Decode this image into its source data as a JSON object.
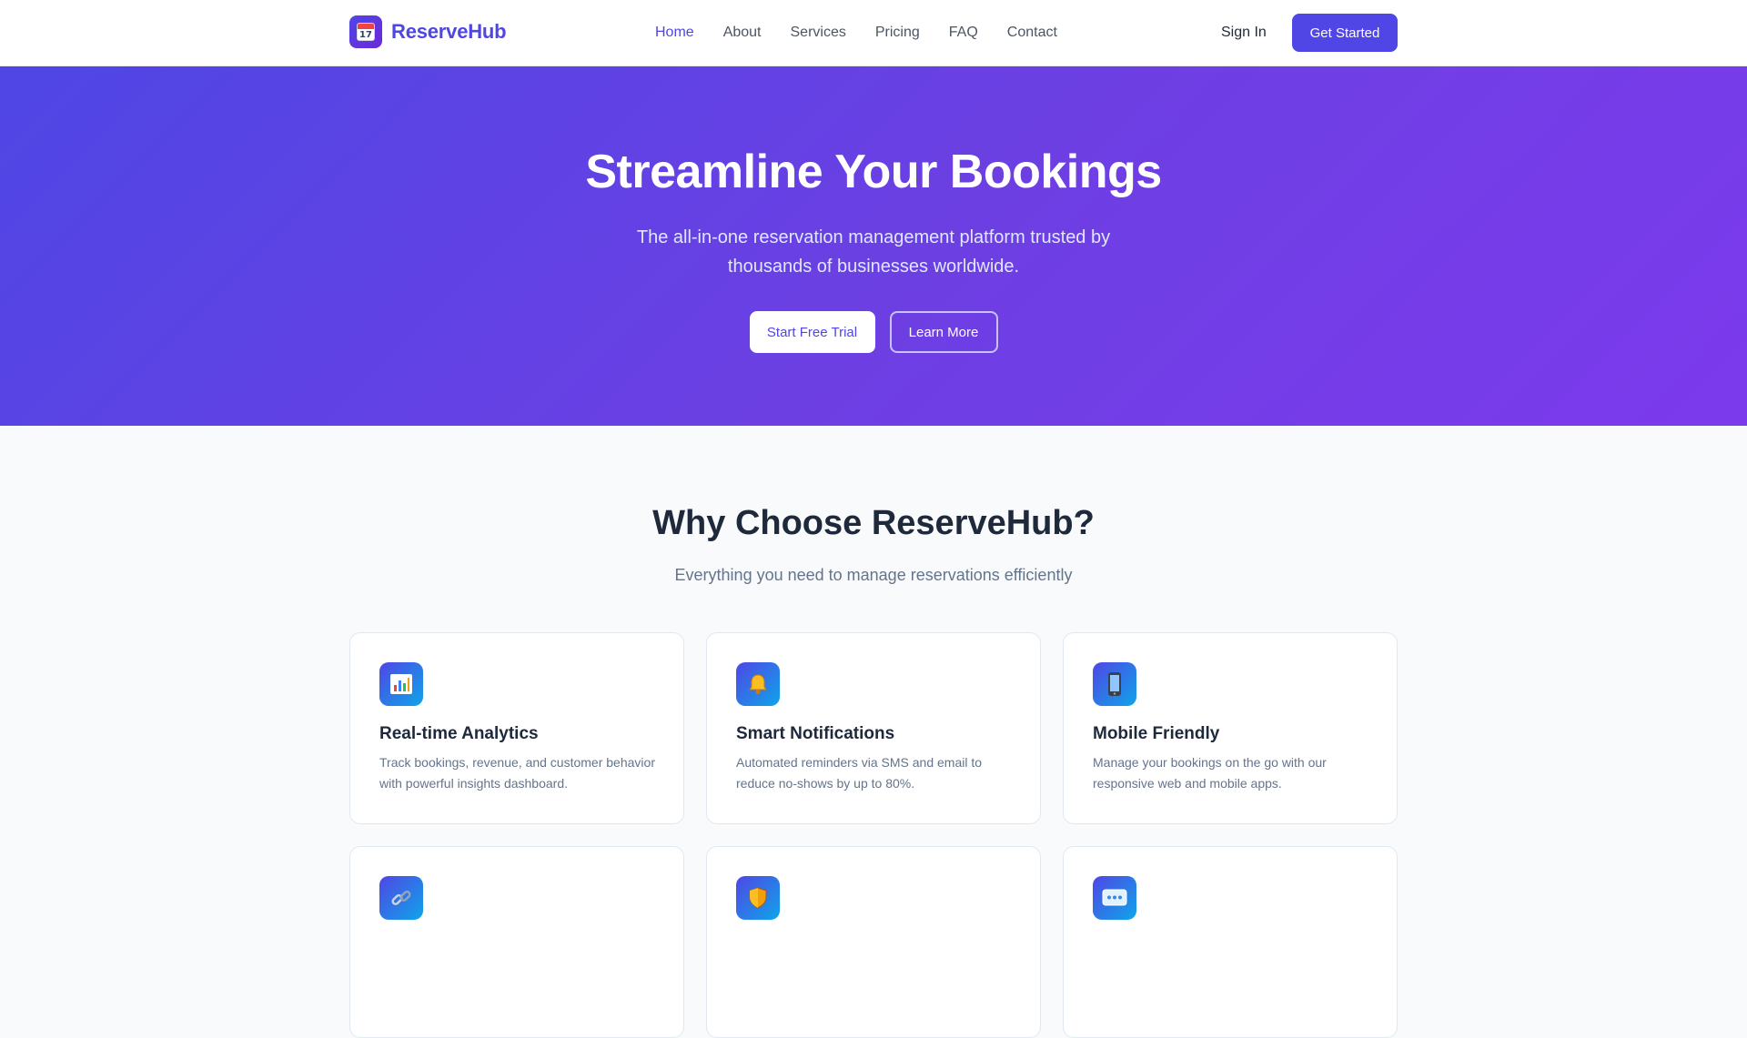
{
  "brand": {
    "name": "ReserveHub",
    "logo_icon": "calendar-icon",
    "logo_day": "17"
  },
  "nav": {
    "links": [
      {
        "label": "Home",
        "active": true
      },
      {
        "label": "About",
        "active": false
      },
      {
        "label": "Services",
        "active": false
      },
      {
        "label": "Pricing",
        "active": false
      },
      {
        "label": "FAQ",
        "active": false
      },
      {
        "label": "Contact",
        "active": false
      }
    ],
    "sign_in": "Sign In",
    "get_started": "Get Started"
  },
  "hero": {
    "title": "Streamline Your Bookings",
    "subtitle": "The all-in-one reservation management platform trusted by thousands of businesses worldwide.",
    "primary_button": "Start Free Trial",
    "secondary_button": "Learn More"
  },
  "features": {
    "title": "Why Choose ReserveHub?",
    "subtitle": "Everything you need to manage reservations efficiently",
    "cards": [
      {
        "icon": "bar-chart-icon",
        "title": "Real-time Analytics",
        "description": "Track bookings, revenue, and customer behavior with powerful insights dashboard."
      },
      {
        "icon": "bell-icon",
        "title": "Smart Notifications",
        "description": "Automated reminders via SMS and email to reduce no-shows by up to 80%."
      },
      {
        "icon": "mobile-phone-icon",
        "title": "Mobile Friendly",
        "description": "Manage your bookings on the go with our responsive web and mobile apps."
      },
      {
        "icon": "link-icon",
        "title": "",
        "description": ""
      },
      {
        "icon": "shield-icon",
        "title": "",
        "description": ""
      },
      {
        "icon": "chat-icon",
        "title": "",
        "description": ""
      }
    ]
  },
  "colors": {
    "primary": "#4f46e5",
    "hero_gradient_start": "#4f46e5",
    "hero_gradient_end": "#7c3aed",
    "heading": "#1e293b",
    "muted": "#64748b"
  }
}
